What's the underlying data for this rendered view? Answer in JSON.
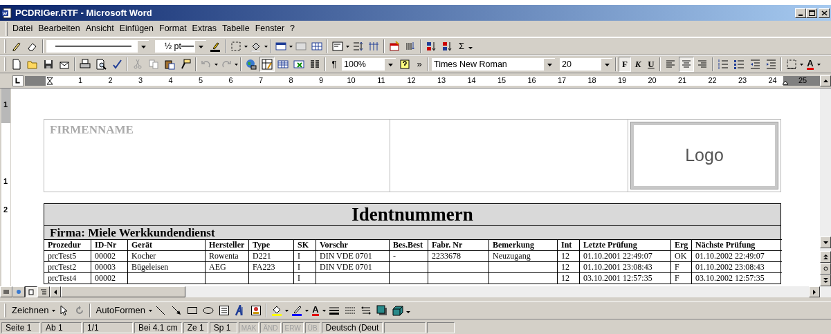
{
  "window": {
    "title": "PCDRIGer.RTF - Microsoft Word"
  },
  "menu": [
    "Datei",
    "Bearbeiten",
    "Ansicht",
    "Einfügen",
    "Format",
    "Extras",
    "Tabelle",
    "Fenster",
    "?"
  ],
  "tables_toolbar": {
    "line_weight": "½ pt",
    "sum": "Σ"
  },
  "standard_toolbar": {
    "pilcrow": "¶",
    "zoom": "100%",
    "more": "»"
  },
  "formatting_toolbar": {
    "font": "Times New Roman",
    "size": "20",
    "style_buttons": [
      {
        "kind": "bold",
        "label": "F",
        "on": true
      },
      {
        "kind": "italic",
        "label": "K",
        "on": false
      },
      {
        "kind": "underline",
        "label": "U",
        "on": false
      }
    ],
    "alignment": [
      {
        "kind": "left",
        "selected": false
      },
      {
        "kind": "center",
        "selected": true
      },
      {
        "kind": "right",
        "selected": false
      }
    ],
    "font_color": "A"
  },
  "ruler": {
    "marks": [
      "1",
      "2",
      "3",
      "4",
      "5",
      "6",
      "7",
      "8",
      "9",
      "10",
      "11",
      "12",
      "13",
      "14",
      "15",
      "16",
      "17",
      "18",
      "19",
      "20",
      "21",
      "22",
      "23",
      "24",
      "25"
    ]
  },
  "vertical_ruler": {
    "marks": [
      "1",
      "1",
      "2"
    ]
  },
  "header_box": {
    "company": "FIRMENNAME",
    "logo": "Logo"
  },
  "report": {
    "title": "Identnummern",
    "company": "Firma: Miele Werkkundendienst",
    "columns": [
      "Prozedur",
      "ID-Nr",
      "Gerät",
      "Hersteller",
      "Type",
      "SK",
      "Vorschr",
      "Bes.Best",
      "Fabr. Nr",
      "Bemerkung",
      "Int",
      "Letzte Prüfung",
      "Erg",
      "Nächste Prüfung"
    ],
    "rows": [
      [
        "prcTest5",
        "00002",
        "Kocher",
        "Rowenta",
        "D221",
        "I",
        "DIN VDE 0701",
        "-",
        "2233678",
        "Neuzugang",
        "12",
        "01.10.2001 22:49:07",
        "OK",
        "01.10.2002 22:49:07"
      ],
      [
        "prcTest2",
        "00003",
        "Bügeleisen",
        "AEG",
        "FA223",
        "I",
        "DIN VDE 0701",
        "",
        "",
        "",
        "12",
        "01.10.2001 23:08:43",
        "F",
        "01.10.2002 23:08:43"
      ],
      [
        "prcTest4",
        "00002",
        "",
        "",
        "",
        "I",
        "",
        "",
        "",
        "",
        "12",
        "03.10.2001 12:57:35",
        "F",
        "03.10.2002 12:57:35"
      ]
    ]
  },
  "drawing_toolbar": {
    "draw": "Zeichnen",
    "autoshapes": "AutoFormen",
    "font_color": "A"
  },
  "status_bar": [
    {
      "text": "Seite 1",
      "disabled": false
    },
    {
      "text": "Ab 1",
      "disabled": false
    },
    {
      "text": "1/1",
      "disabled": false
    },
    {
      "text": "Bei 4.1 cm",
      "disabled": false
    },
    {
      "text": "Ze 1",
      "disabled": false
    },
    {
      "text": "Sp 1",
      "disabled": false
    },
    {
      "text": "MAK",
      "disabled": true
    },
    {
      "text": "ÄND",
      "disabled": true
    },
    {
      "text": "ERW",
      "disabled": true
    },
    {
      "text": "ÜB",
      "disabled": true
    },
    {
      "text": "Deutsch (Deut",
      "disabled": false
    }
  ]
}
